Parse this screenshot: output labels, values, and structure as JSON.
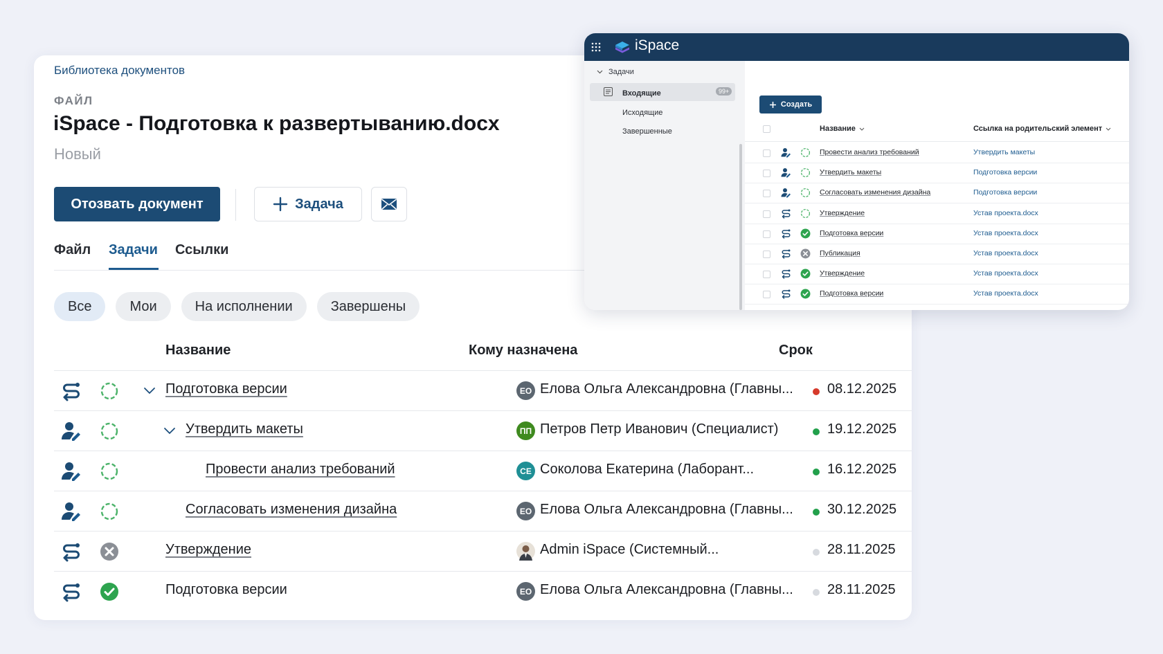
{
  "colors": {
    "brand": "#1c4b74",
    "accent": "#1d5b8f",
    "overdue": "#d63a2b",
    "on_time": "#22a04b",
    "neutral": "#d7dadf",
    "topbar": "#193a5c",
    "done": "#2ea44f",
    "cancelled": "#8b8f96"
  },
  "doc": {
    "breadcrumb": "Библиотека документов",
    "label": "ФАЙЛ",
    "title": "iSpace - Подготовка к развертыванию.docx",
    "status": "Новый"
  },
  "actions": {
    "recall_label": "Отозвать документ",
    "task_label": "Задача",
    "task_icon": "plus-icon",
    "mail_icon": "mail-icon"
  },
  "tabs": [
    {
      "label": "Файл"
    },
    {
      "label": "Задачи",
      "active": true
    },
    {
      "label": "Ссылки"
    }
  ],
  "filters": [
    {
      "label": "Все",
      "active": true
    },
    {
      "label": "Мои"
    },
    {
      "label": "На исполнении"
    },
    {
      "label": "Завершены"
    }
  ],
  "table": {
    "headers": {
      "name": "Название",
      "assignee": "Кому назначена",
      "due": "Срок"
    },
    "rows": [
      {
        "type": "route-icon",
        "status": "pending-icon",
        "expandable": true,
        "indent": 0,
        "name": "Подготовка версии",
        "link": true,
        "initials": "ЕО",
        "avatar_color": "#5c6670",
        "assignee": "Елова Ольга Александровна (Главны...",
        "dot": "overdue",
        "due": "08.12.2025"
      },
      {
        "type": "user-icon",
        "status": "pending-icon",
        "expandable": true,
        "indent": 1,
        "name": "Утвердить макеты",
        "link": true,
        "initials": "ПП",
        "avatar_color": "#3f8a1f",
        "assignee": "Петров Петр Иванович (Специалист)",
        "dot": "on_time",
        "due": "19.12.2025"
      },
      {
        "type": "user-icon",
        "status": "pending-icon",
        "expandable": false,
        "indent": 2,
        "name": "Провести анализ требований",
        "link": true,
        "initials": "СЕ",
        "avatar_color": "#1f8f95",
        "assignee": "Соколова Екатерина (Лаборант...",
        "dot": "on_time",
        "due": "16.12.2025"
      },
      {
        "type": "user-icon",
        "status": "pending-icon",
        "expandable": false,
        "indent": 1,
        "name": "Согласовать изменения дизайна",
        "link": true,
        "initials": "ЕО",
        "avatar_color": "#5c6670",
        "assignee": "Елова Ольга Александровна (Главны...",
        "dot": "on_time",
        "due": "30.12.2025"
      },
      {
        "type": "route-icon",
        "status": "cancelled-icon",
        "expandable": false,
        "indent": 0,
        "name": "Утверждение",
        "link": true,
        "initials": "",
        "avatar_color": "photo",
        "assignee": "Admin iSpace (Системный...",
        "dot": "neutral",
        "due": "28.11.2025"
      },
      {
        "type": "route-icon",
        "status": "done-icon",
        "expandable": false,
        "indent": 0,
        "name": "Подготовка версии",
        "link": false,
        "initials": "ЕО",
        "avatar_color": "#5c6670",
        "assignee": "Елова Ольга Александровна (Главны...",
        "dot": "neutral",
        "due": "28.11.2025"
      }
    ]
  },
  "window": {
    "brand": "iSpace",
    "sidebar": {
      "section": "Задачи",
      "items": [
        {
          "label": "Входящие",
          "badge": "99+",
          "active": true
        },
        {
          "label": "Исходящие"
        },
        {
          "label": "Завершенные"
        }
      ]
    },
    "create_label": "Создать",
    "headers": {
      "name": "Название",
      "parent": "Ссылка на родительский элемент"
    },
    "rows": [
      {
        "type": "user-icon",
        "status": "pending-icon",
        "name": "Провести анализ требований",
        "parent": "Утвердить макеты"
      },
      {
        "type": "user-icon",
        "status": "pending-icon",
        "name": "Утвердить макеты",
        "parent": "Подготовка версии"
      },
      {
        "type": "user-icon",
        "status": "pending-icon",
        "name": "Согласовать изменения дизайна",
        "parent": "Подготовка версии"
      },
      {
        "type": "route-icon",
        "status": "pending-icon",
        "name": "Утверждение",
        "parent": "Устав проекта.docx"
      },
      {
        "type": "route-icon",
        "status": "done-icon",
        "name": "Подготовка версии",
        "parent": "Устав проекта.docx"
      },
      {
        "type": "route-icon",
        "status": "cancelled-icon",
        "name": "Публикация",
        "parent": "Устав проекта.docx"
      },
      {
        "type": "route-icon",
        "status": "done-icon",
        "name": "Утверждение",
        "parent": "Устав проекта.docx"
      },
      {
        "type": "route-icon",
        "status": "done-icon",
        "name": "Подготовка версии",
        "parent": "Устав проекта.docx"
      }
    ]
  }
}
